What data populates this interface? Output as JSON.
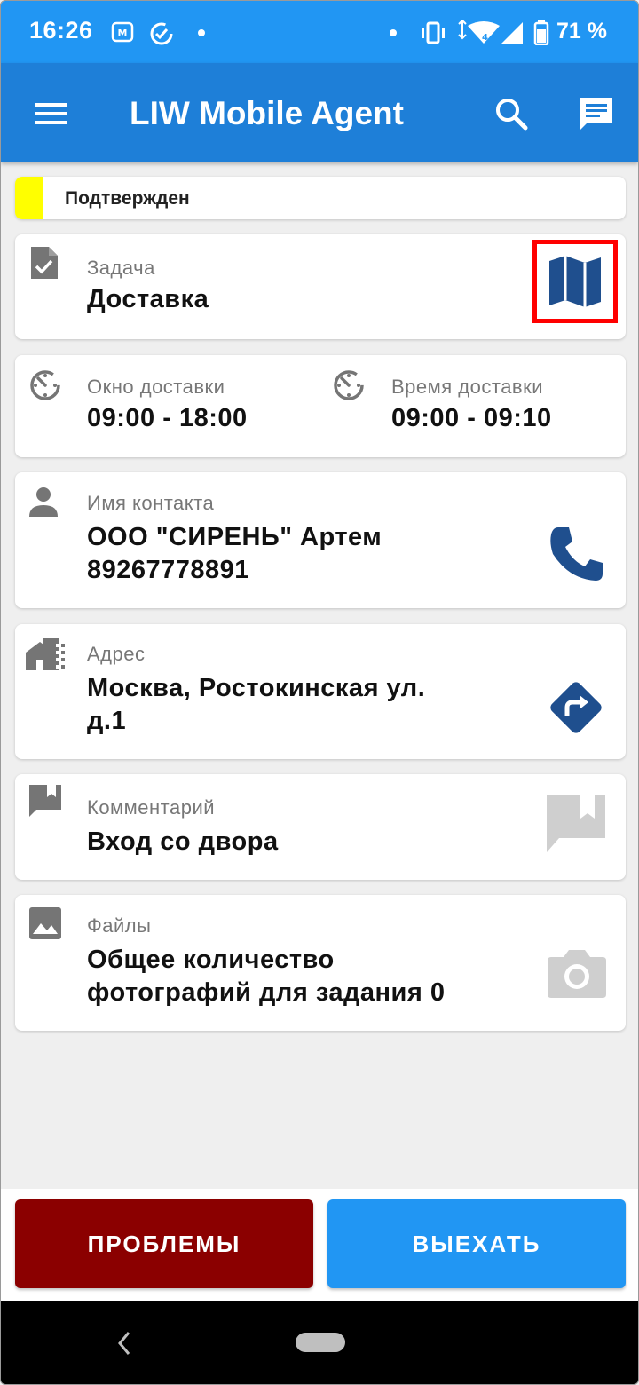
{
  "statusbar": {
    "time": "16:26",
    "battery": "71 %"
  },
  "appbar": {
    "title": "LIW Mobile Agent"
  },
  "status": {
    "label": "Подтвержден",
    "color": "#ffff00"
  },
  "task": {
    "label": "Задача",
    "value": "Доставка"
  },
  "delivery": {
    "window_label": "Окно доставки",
    "window_value": "09:00 - 18:00",
    "time_label": "Время доставки",
    "time_value": "09:00 - 09:10"
  },
  "contact": {
    "label": "Имя контакта",
    "line1": "ООО \"СИРЕНЬ\" Артем",
    "line2": "89267778891"
  },
  "address": {
    "label": "Адрес",
    "line1": "Москва, Ростокинская ул.",
    "line2": "д.1"
  },
  "comment": {
    "label": "Комментарий",
    "value": "Вход со двора"
  },
  "files": {
    "label": "Файлы",
    "line1": "Общее количество",
    "line2": "фотографий для задания 0"
  },
  "buttons": {
    "problems": "ПРОБЛЕМЫ",
    "leave": "ВЫЕХАТЬ"
  },
  "colors": {
    "statusbar": "#2196f3",
    "appbar": "#1e7fd8",
    "accent_dark": "#1f4f8e",
    "problems": "#8b0000",
    "leave": "#2196f3",
    "highlight": "#ff0000"
  },
  "icons": [
    "menu-icon",
    "search-icon",
    "chat-icon",
    "task-doc-icon",
    "map-icon",
    "timer-icon",
    "person-icon",
    "phone-icon",
    "building-icon",
    "directions-icon",
    "comment-icon",
    "image-icon",
    "camera-icon"
  ]
}
